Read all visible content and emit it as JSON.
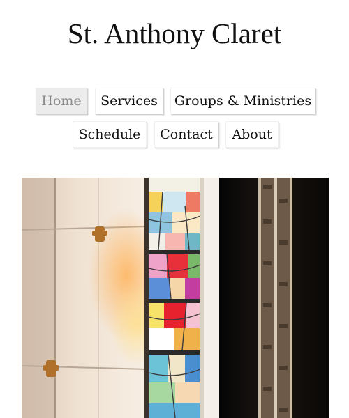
{
  "site": {
    "title": "St. Anthony Claret"
  },
  "nav": {
    "items": [
      {
        "label": "Home",
        "active": true
      },
      {
        "label": "Services",
        "active": false
      },
      {
        "label": "Groups & Ministries",
        "active": false
      },
      {
        "label": "Schedule",
        "active": false
      },
      {
        "label": "Contact",
        "active": false
      },
      {
        "label": "About",
        "active": false
      }
    ]
  },
  "hero": {
    "subject": "stained glass window in church interior"
  },
  "colors": {
    "nav_active_bg": "#ececec",
    "nav_active_text": "#8a8a8a",
    "text": "#111111"
  }
}
